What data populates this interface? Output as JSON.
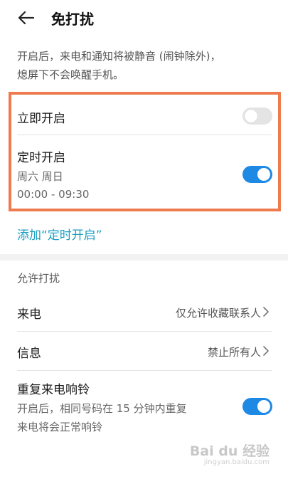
{
  "header": {
    "title": "免打扰"
  },
  "description": {
    "line1": "开启后，来电和通知将被静音 (闹钟除外)，",
    "line2": "熄屏下不会唤醒手机。"
  },
  "immediate": {
    "label": "立即开启",
    "enabled": false
  },
  "scheduled": {
    "label": "定时开启",
    "days": "周六 周日",
    "time": "00:00 - 09:30",
    "enabled": true
  },
  "add_schedule": {
    "label": "添加“定时开启”"
  },
  "allow_section": {
    "title": "允许打扰",
    "calls": {
      "label": "来电",
      "value": "仅允许收藏联系人"
    },
    "messages": {
      "label": "信息",
      "value": "禁止所有人"
    },
    "repeat_calls": {
      "label": "重复来电响铃",
      "desc_line1": "开启后，相同号码在 15 分钟内重复",
      "desc_line2": "来电将会正常响铃",
      "enabled": true
    }
  },
  "watermark": {
    "brand": "Bai du 经验",
    "url": "jingyan.baidu.com"
  },
  "colors": {
    "accent": "#1e88e5",
    "link": "#1c9ec2",
    "highlight": "#ee7b4e"
  }
}
